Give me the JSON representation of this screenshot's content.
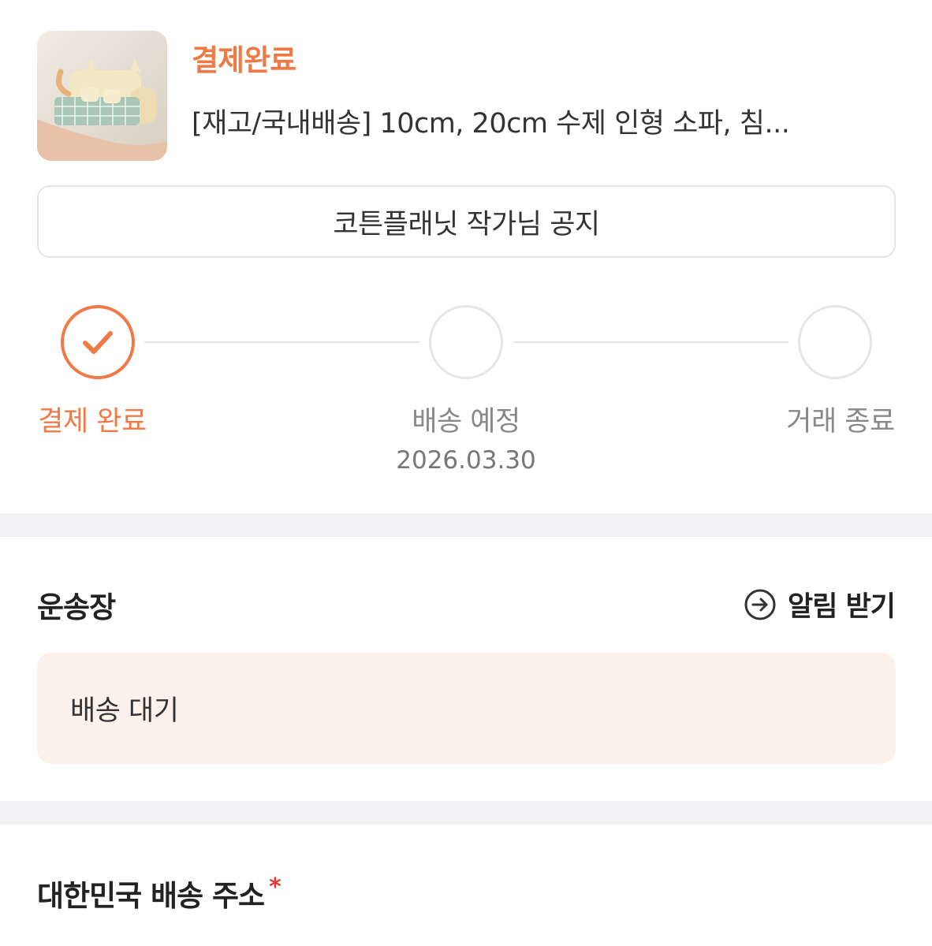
{
  "order": {
    "status": "결제완료",
    "product_title": "[재고/국내배송] 10cm, 20cm 수제 인형 소파, 침...",
    "notice_button": "코튼플래닛 작가님 공지"
  },
  "progress": {
    "steps": [
      {
        "label": "결제 완료",
        "done": true
      },
      {
        "label": "배송 예정",
        "date": "2026.03.30",
        "done": false
      },
      {
        "label": "거래 종료",
        "done": false
      }
    ]
  },
  "tracking": {
    "title": "운송장",
    "alert_label": "알림 받기",
    "status": "배송 대기"
  },
  "address": {
    "title": "대한민국 배송 주소",
    "required_mark": "*"
  },
  "colors": {
    "accent": "#ef7a45",
    "tracking_bg": "#fdf1eb",
    "divider": "#f2f2f4",
    "required": "#e53935"
  },
  "icons": {
    "check": "check-icon",
    "alert": "circle-arrow-right-icon"
  }
}
